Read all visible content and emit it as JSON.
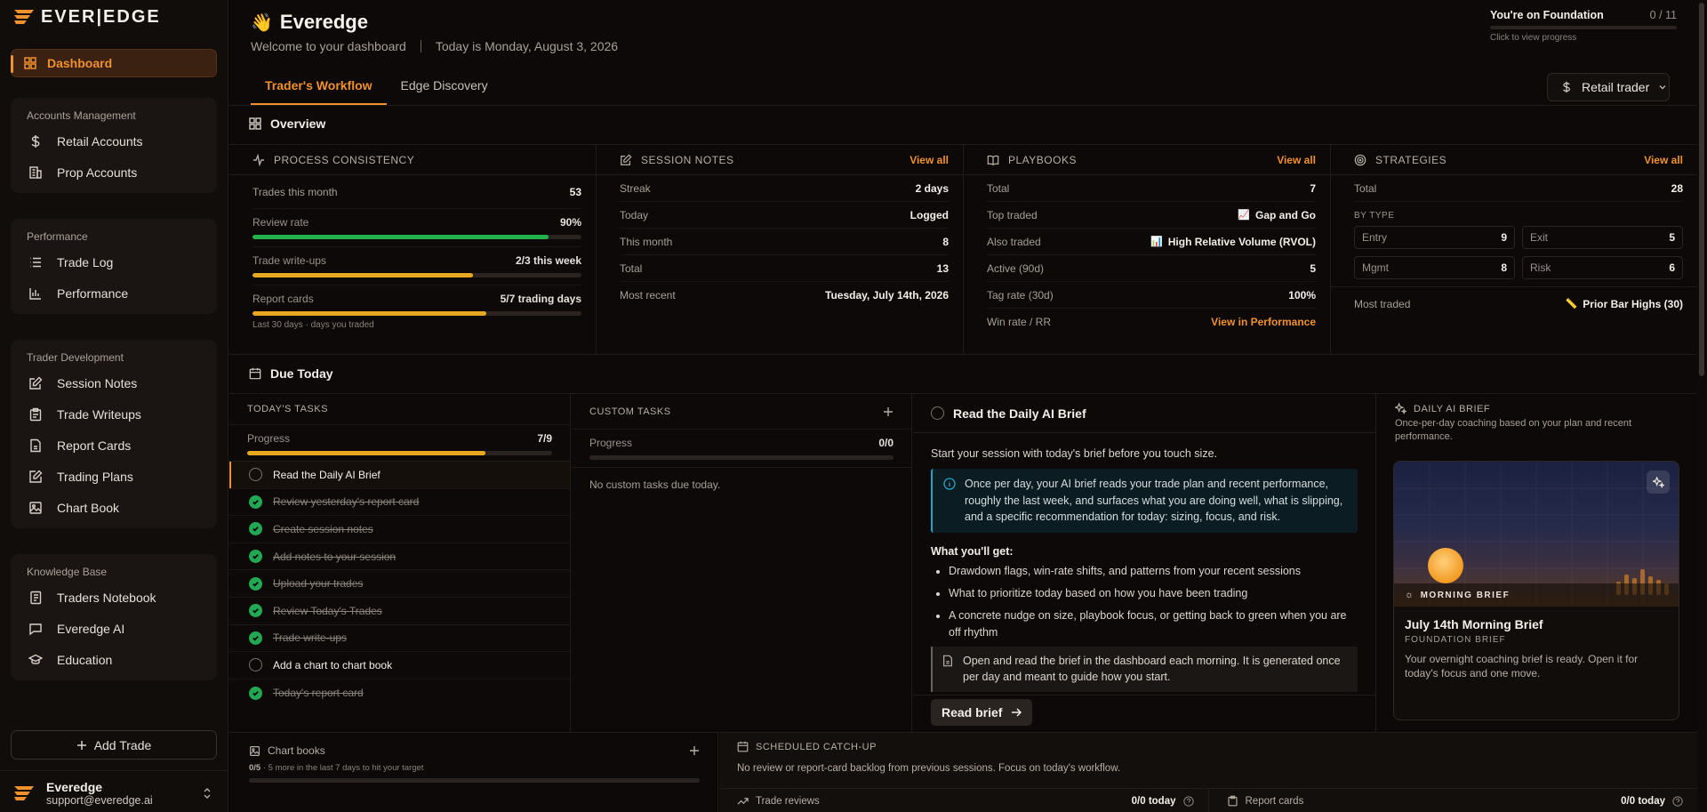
{
  "brand": {
    "name": "EVER|EDGE",
    "accent": "#f0912e"
  },
  "sidebar": {
    "dashboard": "Dashboard",
    "groups": [
      {
        "title": "Accounts Management",
        "items": [
          {
            "label": "Retail Accounts",
            "icon": "dollar-icon"
          },
          {
            "label": "Prop Accounts",
            "icon": "building-icon"
          }
        ]
      },
      {
        "title": "Performance",
        "items": [
          {
            "label": "Trade Log",
            "icon": "list-icon"
          },
          {
            "label": "Performance",
            "icon": "bar-chart-icon"
          }
        ]
      },
      {
        "title": "Trader Development",
        "items": [
          {
            "label": "Session Notes",
            "icon": "edit-note-icon"
          },
          {
            "label": "Trade Writeups",
            "icon": "clipboard-icon"
          },
          {
            "label": "Report Cards",
            "icon": "document-icon"
          },
          {
            "label": "Trading Plans",
            "icon": "pencil-square-icon"
          },
          {
            "label": "Chart Book",
            "icon": "image-icon"
          }
        ]
      },
      {
        "title": "Knowledge Base",
        "items": [
          {
            "label": "Traders Notebook",
            "icon": "notebook-icon"
          },
          {
            "label": "Everedge AI",
            "icon": "chat-icon"
          },
          {
            "label": "Education",
            "icon": "graduation-cap-icon"
          }
        ]
      }
    ],
    "add_trade": "Add Trade",
    "user": {
      "name": "Everedge",
      "email": "support@everedge.ai"
    }
  },
  "header": {
    "title": "Everedge",
    "welcome": "Welcome to your dashboard",
    "today": "Today is Monday, August 3, 2026",
    "foundation": {
      "label": "You're on Foundation",
      "count": "0 / 11",
      "sub": "Click to view progress",
      "progress": 0
    }
  },
  "tabs": [
    "Trader's Workflow",
    "Edge Discovery"
  ],
  "trader_select": "Retail trader",
  "overview": {
    "title": "Overview",
    "process": {
      "title": "PROCESS CONSISTENCY",
      "trades_label": "Trades this month",
      "trades_value": "53",
      "review_label": "Review rate",
      "review_value": "90%",
      "review_pct": 90,
      "writeups_label": "Trade write-ups",
      "writeups_value": "2/3 this week",
      "writeups_pct": 67,
      "report_label": "Report cards",
      "report_value": "5/7 trading days",
      "report_pct": 71,
      "report_note": "Last 30 days · days you traded"
    },
    "session": {
      "title": "SESSION NOTES",
      "view_all": "View all",
      "rows": [
        {
          "k": "Streak",
          "v": "2 days"
        },
        {
          "k": "Today",
          "v": "Logged"
        },
        {
          "k": "This month",
          "v": "8"
        },
        {
          "k": "Total",
          "v": "13"
        },
        {
          "k": "Most recent",
          "v": "Tuesday, July 14th, 2026"
        }
      ]
    },
    "playbooks": {
      "title": "PLAYBOOKS",
      "view_all": "View all",
      "rows": [
        {
          "k": "Total",
          "v": "7"
        },
        {
          "k": "Top traded",
          "v": "Gap and Go"
        },
        {
          "k": "Also traded",
          "v": "High Relative Volume (RVOL)"
        },
        {
          "k": "Active (90d)",
          "v": "5"
        },
        {
          "k": "Tag rate (30d)",
          "v": "100%"
        },
        {
          "k": "Win rate / RR",
          "v": "View in Performance"
        }
      ]
    },
    "strategies": {
      "title": "STRATEGIES",
      "view_all": "View all",
      "total_label": "Total",
      "total": "28",
      "by_type": "BY TYPE",
      "types": [
        {
          "k": "Entry",
          "v": "9"
        },
        {
          "k": "Exit",
          "v": "5"
        },
        {
          "k": "Mgmt",
          "v": "8"
        },
        {
          "k": "Risk",
          "v": "6"
        }
      ],
      "most_label": "Most traded",
      "most_value": "Prior Bar Highs (30)"
    }
  },
  "due": {
    "title": "Due Today",
    "todays": {
      "title": "TODAY'S TASKS",
      "progress_label": "Progress",
      "progress_value": "7/9",
      "progress_pct": 78,
      "tasks": [
        {
          "label": "Read the Daily AI Brief",
          "done": false,
          "current": true
        },
        {
          "label": "Review yesterday's report card",
          "done": true
        },
        {
          "label": "Create session notes",
          "done": true
        },
        {
          "label": "Add notes to your session",
          "done": true
        },
        {
          "label": "Upload your trades",
          "done": true
        },
        {
          "label": "Review Today's Trades",
          "done": true
        },
        {
          "label": "Trade write-ups",
          "done": true
        },
        {
          "label": "Add a chart to chart book",
          "done": false
        },
        {
          "label": "Today's report card",
          "done": true
        }
      ]
    },
    "custom": {
      "title": "CUSTOM TASKS",
      "progress_label": "Progress",
      "progress_value": "0/0",
      "empty": "No custom tasks due today."
    },
    "brief": {
      "title": "Read the Daily AI Brief",
      "intro": "Start your session with today's brief before you touch size.",
      "info": "Once per day, your AI brief reads your trade plan and recent performance, roughly the last week, and surfaces what you are doing well, what is slipping, and a specific recommendation for today: sizing, focus, and risk.",
      "get_title": "What you'll get:",
      "bullets": [
        "Drawdown flags, win-rate shifts, and patterns from your recent sessions",
        "What to prioritize today based on how you have been trading",
        "A concrete nudge on size, playbook focus, or getting back to green when you are off rhythm"
      ],
      "note": "Open and read the brief in the dashboard each morning. It is generated once per day and meant to guide how you start.",
      "button": "Read brief"
    },
    "daily": {
      "title": "DAILY AI BRIEF",
      "sub": "Once-per-day coaching based on your plan and recent performance.",
      "badge": "MORNING BRIEF",
      "card_title": "July 14th Morning Brief",
      "card_kicker": "FOUNDATION BRIEF",
      "card_text": "Your overnight coaching brief is ready. Open it for today's focus and one move."
    }
  },
  "bottom": {
    "chart_books": {
      "title": "Chart books",
      "count": "0/5",
      "note": "· 5 more in the last 7 days to hit your target"
    },
    "catchup": {
      "title": "SCHEDULED CATCH-UP",
      "text": "No review or report-card backlog from previous sessions. Focus on today's workflow.",
      "reviews_label": "Trade reviews",
      "reviews_value": "0/0 today",
      "reports_label": "Report cards",
      "reports_value": "0/0 today"
    }
  }
}
